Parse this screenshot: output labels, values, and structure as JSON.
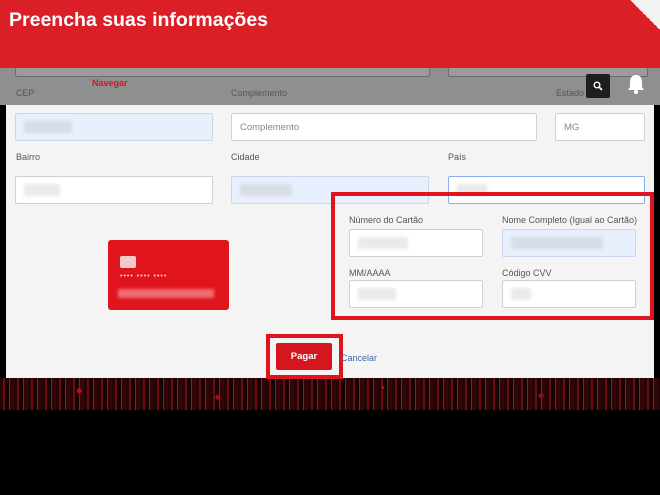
{
  "header": {
    "title": "Preencha suas informações"
  },
  "nav": {
    "link_label": "Navegar"
  },
  "icons": {
    "search": "search-icon",
    "bell": "bell-icon"
  },
  "colors": {
    "brand": "#da1f26",
    "highlight": "#e0141c",
    "autofill": "#e8f0fe"
  },
  "address": {
    "cep_label": "CEP",
    "complemento_label": "Complemento",
    "complemento_placeholder": "Complemento",
    "estado_label": "Estado",
    "estado_value": "MG",
    "bairro_label": "Bairro",
    "cidade_label": "Cidade",
    "pais_label": "País"
  },
  "payment": {
    "numero_label": "Número do Cartão",
    "nome_label": "Nome Completo (Igual ao Cartão)",
    "validade_label": "MM/AAAA",
    "cvv_label": "Código CVV",
    "card_number_mask": "•••• •••• ••••"
  },
  "actions": {
    "pay_label": "Pagar",
    "cancel_label": "Cancelar"
  }
}
